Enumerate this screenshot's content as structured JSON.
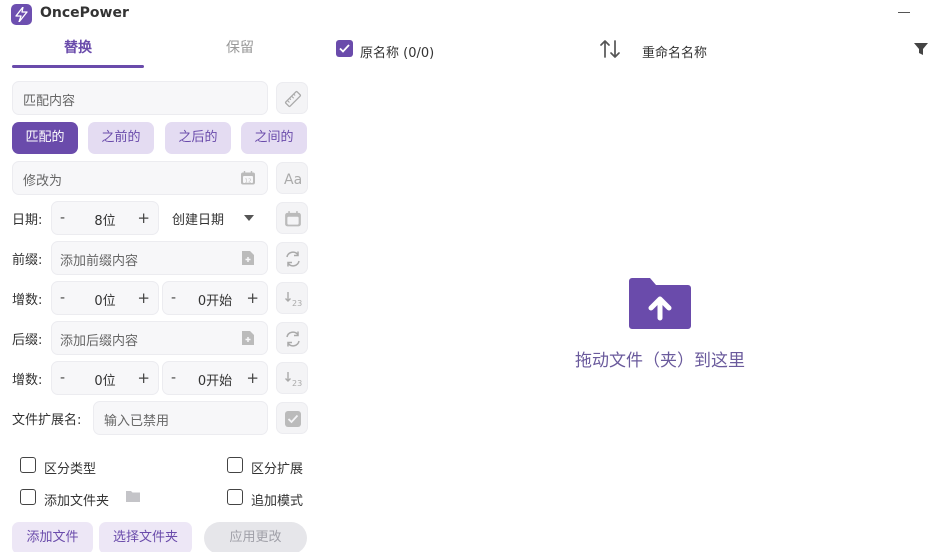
{
  "app": {
    "name": "OncePower"
  },
  "tabs": [
    {
      "label": "替换",
      "active": true
    },
    {
      "label": "保留",
      "active": false
    }
  ],
  "replace": {
    "match_placeholder": "匹配内容",
    "modes": [
      "匹配的",
      "之前的",
      "之后的",
      "之间的"
    ],
    "modify_placeholder": "修改为"
  },
  "date": {
    "label": "日期:",
    "digits": "8位",
    "type": "创建日期"
  },
  "prefix": {
    "label": "前缀:",
    "placeholder": "添加前缀内容"
  },
  "increment1": {
    "label": "增数:",
    "digits": "0位",
    "start": "0开始"
  },
  "suffix": {
    "label": "后缀:",
    "placeholder": "添加后缀内容"
  },
  "increment2": {
    "label": "增数:",
    "digits": "0位",
    "start": "0开始"
  },
  "extension": {
    "label": "文件扩展名:",
    "placeholder": "输入已禁用"
  },
  "options": {
    "distinguish_type": "区分类型",
    "distinguish_ext": "区分扩展",
    "add_folder": "添加文件夹",
    "append_mode": "追加模式"
  },
  "actions": {
    "add_file": "添加文件",
    "select_folder": "选择文件夹",
    "apply": "应用更改"
  },
  "list_header": {
    "original_name": "原名称 (0/0)",
    "new_name": "重命名名称"
  },
  "dropzone": {
    "text": "拖动文件（夹）到这里"
  },
  "colors": {
    "accent": "#6a4bab",
    "accent_light": "#e4dcf2"
  }
}
